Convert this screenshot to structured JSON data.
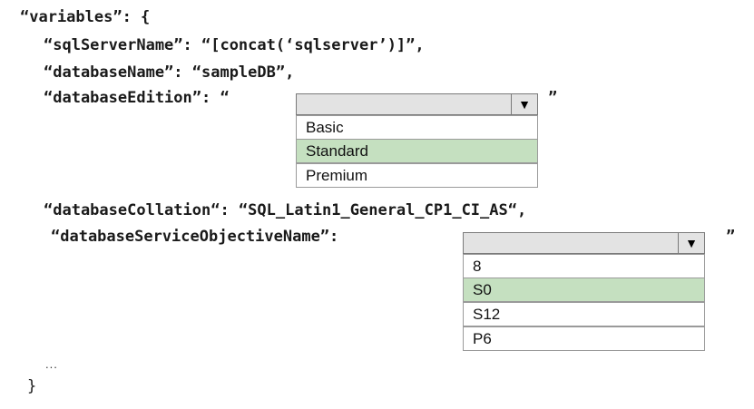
{
  "code": {
    "line1": "“variables”: {",
    "line2": "“sqlServerName”: “[concat(‘sqlserver’)]”,",
    "line3": "“databaseName”: “sampleDB”,",
    "line4_prefix": "“databaseEdition”: “",
    "line4_suffix": "”",
    "line5": "“databaseCollation“: “SQL_Latin1_General_CP1_CI_AS“,",
    "line6_prefix": "“databaseServiceObjectiveName”:",
    "line6_suffix": "”",
    "ellipsis": "...",
    "closing": "}"
  },
  "dropdown_edition": {
    "selected_value": "",
    "arrow_icon": "triangle-down-icon",
    "options": [
      "Basic",
      "Standard",
      "Premium"
    ],
    "highlighted": "Standard"
  },
  "dropdown_objective": {
    "selected_value": "",
    "arrow_icon": "triangle-down-icon",
    "options": [
      "8",
      "S0",
      "S12",
      "P6"
    ],
    "highlighted": "S0"
  },
  "colors": {
    "highlight": "#c5e0c0",
    "header_bg": "#e3e3e3"
  }
}
